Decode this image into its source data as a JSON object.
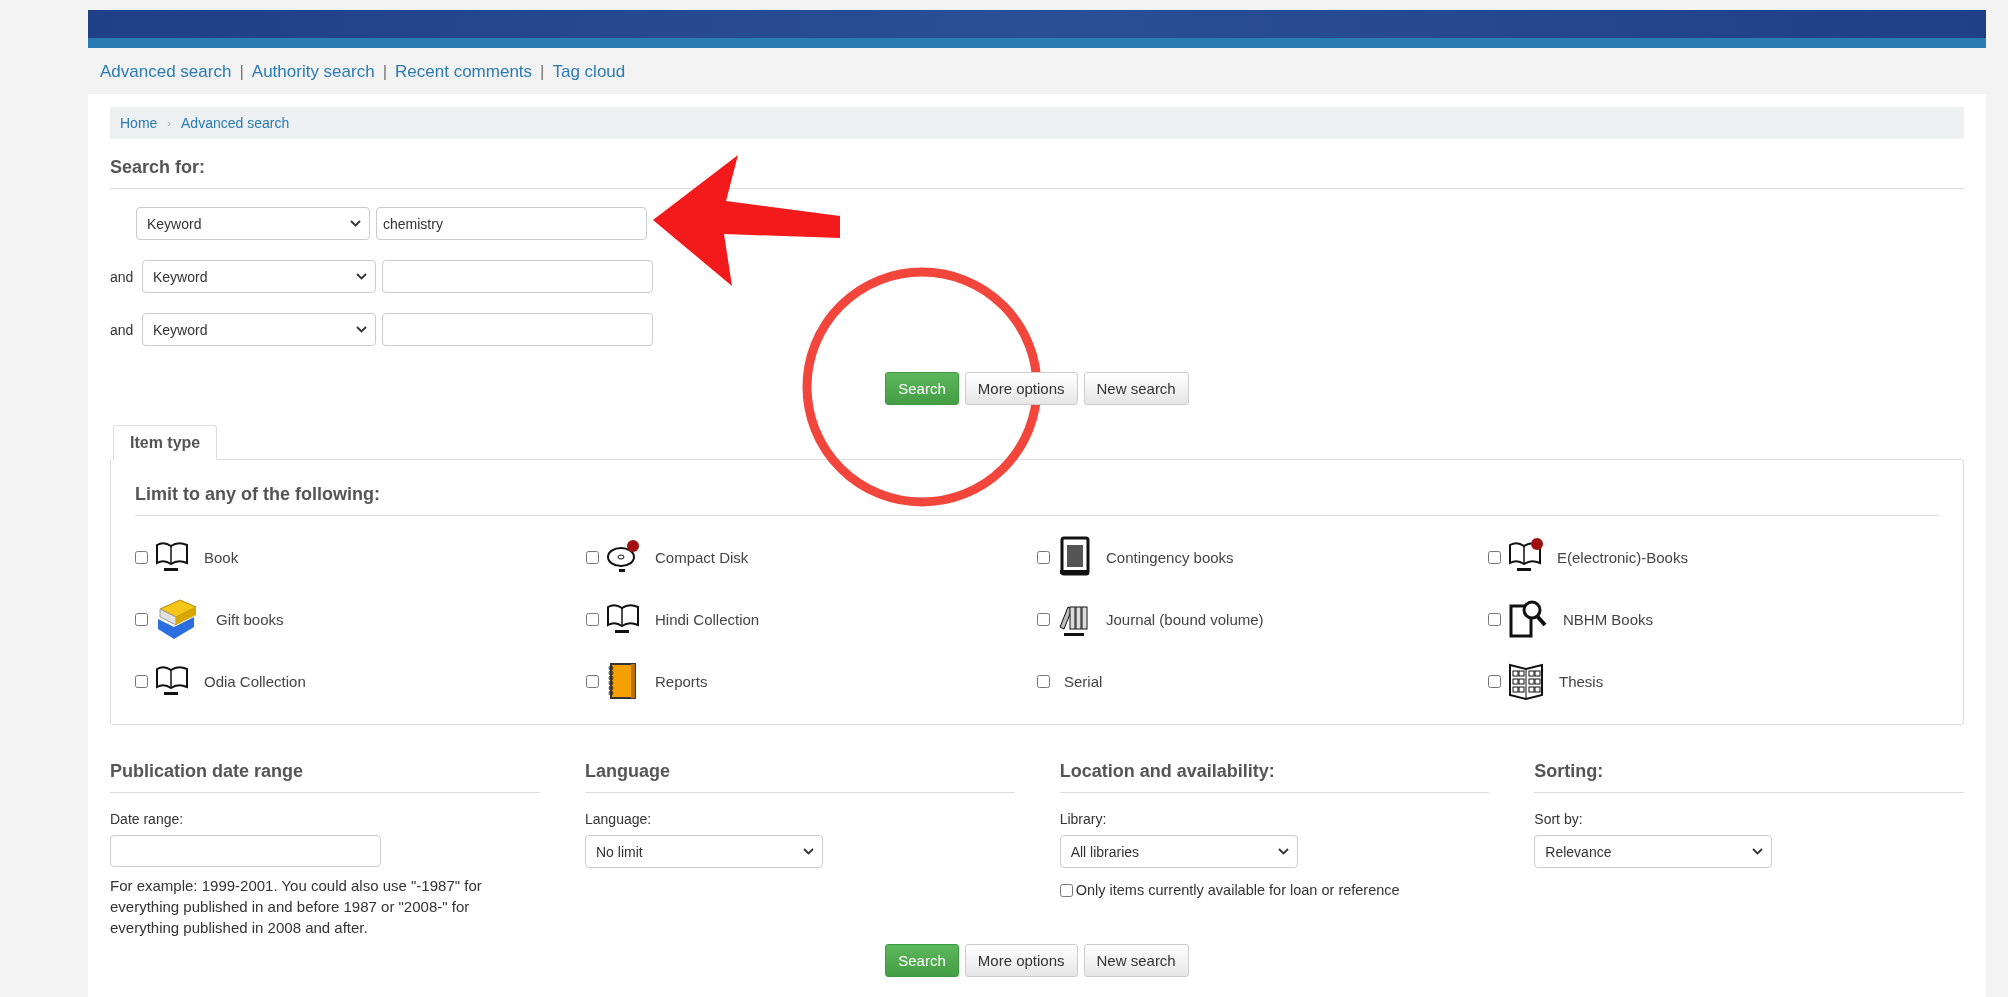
{
  "nav_links": [
    "Advanced search",
    "Authority search",
    "Recent comments",
    "Tag cloud"
  ],
  "nav_separator": "|",
  "breadcrumb": [
    "Home",
    "Advanced search"
  ],
  "breadcrumb_separator": "›",
  "search_for": {
    "title": "Search for:",
    "rows": [
      {
        "operator": "",
        "field": "Keyword",
        "value": "chemistry"
      },
      {
        "operator": "and",
        "field": "Keyword"
      },
      {
        "operator": "and",
        "field": "Keyword"
      }
    ]
  },
  "buttons": [
    "Search",
    "More options",
    "New search"
  ],
  "tabs": [
    {
      "label": "Item type",
      "selected": true
    }
  ],
  "item_type": {
    "title": "Limit to any of the following:",
    "items": [
      {
        "label": "Book",
        "checked": false
      },
      {
        "label": "Compact Disk",
        "checked": false
      },
      {
        "label": "Contingency books",
        "checked": false
      },
      {
        "label": "E(electronic)-Books",
        "checked": false
      },
      {
        "label": "Gift books",
        "checked": false
      },
      {
        "label": "Hindi Collection",
        "checked": false
      },
      {
        "label": "Journal (bound volume)",
        "checked": false
      },
      {
        "label": "NBHM Books",
        "checked": false
      },
      {
        "label": "Odia Collection",
        "checked": false
      },
      {
        "label": "Reports",
        "checked": false
      },
      {
        "label": "Serial",
        "checked": false
      },
      {
        "label": "Thesis",
        "checked": false
      }
    ]
  },
  "sections": [
    {
      "kind": "date",
      "title": "Publication date range",
      "label": "Date range:",
      "help": "For example: 1999-2001. You could also use \"-1987\" for everything published in and before 1987 or \"2008-\" for everything published in 2008 and after."
    },
    {
      "kind": "select",
      "title": "Language",
      "label": "Language:",
      "value": "No limit"
    },
    {
      "kind": "select",
      "title": "Location and availability:",
      "label": "Library:",
      "value": "All libraries",
      "checkbox": {
        "label": "Only items currently available for loan or reference",
        "checked": false
      }
    },
    {
      "kind": "select",
      "title": "Sorting:",
      "label": "Sort by:",
      "value": "Relevance"
    }
  ],
  "bottom_buttons": [
    "Search",
    "More options",
    "New search"
  ],
  "annotations": [
    {
      "kind": "arrow"
    },
    {
      "kind": "circle"
    }
  ]
}
